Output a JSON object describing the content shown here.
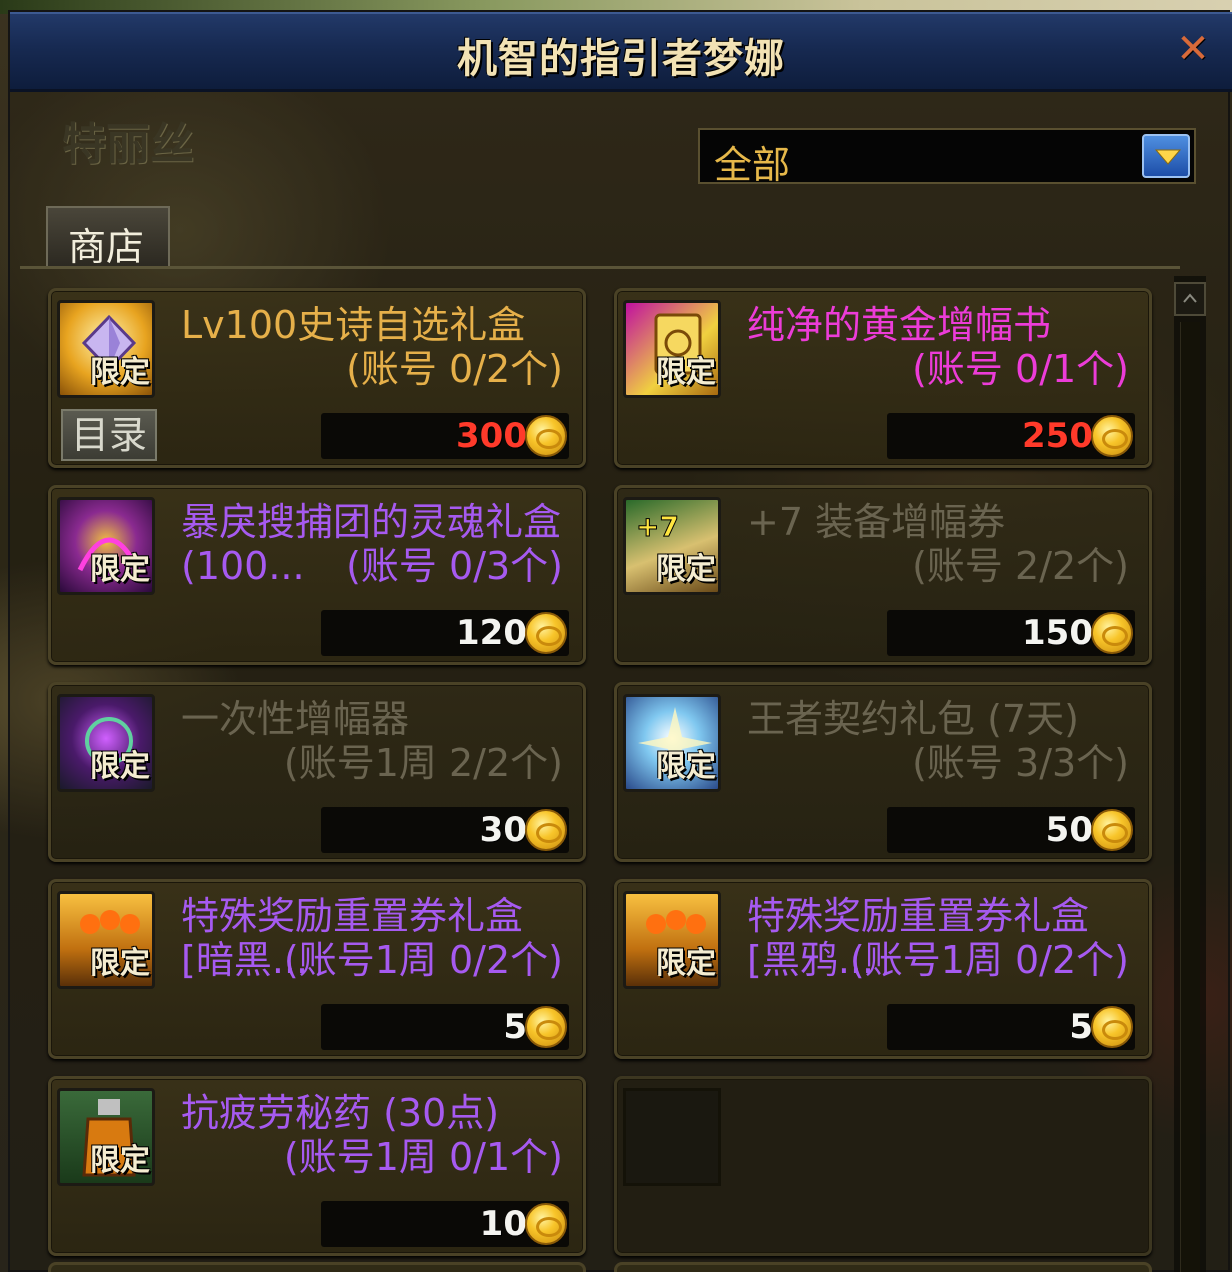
{
  "window": {
    "title": "机智的指引者梦娜",
    "npc_name": "特丽丝",
    "shop_tab": "商店",
    "catalog_button": "目录"
  },
  "filter": {
    "selected": "全部"
  },
  "colors": {
    "title_bar": "#172a52",
    "name_gold": "#e6b04a",
    "name_pink": "#ec3cd8",
    "name_purple": "#a65af0",
    "name_gray": "#6a6450",
    "price_red": "#ff3a2a",
    "price_white": "#f4f4f0"
  },
  "items": [
    {
      "name": "Lv100史诗自选礼盒",
      "limit": "(账号 0/2个)",
      "badge": "限定",
      "price": "300",
      "icon": "epic-box-icon",
      "name_color": "gold",
      "price_color": "red"
    },
    {
      "name": "纯净的黄金增幅书",
      "limit": "(账号 0/1个)",
      "badge": "限定",
      "price": "250",
      "icon": "gold-book-icon",
      "name_color": "pink",
      "price_color": "red"
    },
    {
      "name": "暴戾搜捕团的灵魂礼盒 (100...",
      "limit": "(账号 0/3个)",
      "badge": "限定",
      "price": "120",
      "icon": "soul-box-icon",
      "name_color": "purple",
      "price_color": "white"
    },
    {
      "name": "+7 装备增幅券",
      "limit": "(账号 2/2个)",
      "badge": "限定",
      "price": "150",
      "icon": "amplify-ticket-icon",
      "name_color": "gray",
      "price_color": "white"
    },
    {
      "name": "一次性增幅器",
      "limit": "(账号1周 2/2个)",
      "badge": "限定",
      "price": "30",
      "icon": "amplifier-icon",
      "name_color": "gray",
      "price_color": "white"
    },
    {
      "name": "王者契约礼包 (7天)",
      "limit": "(账号 3/3个)",
      "badge": "限定",
      "price": "50",
      "icon": "contract-pack-icon",
      "name_color": "gray",
      "price_color": "white"
    },
    {
      "name": "特殊奖励重置券礼盒[暗黑...",
      "limit": "(账号1周 0/2个)",
      "badge": "限定",
      "price": "5",
      "icon": "reset-ticket-box-icon",
      "name_color": "purple",
      "price_color": "white"
    },
    {
      "name": "特殊奖励重置券礼盒[黑鸦...",
      "limit": "(账号1周 0/2个)",
      "badge": "限定",
      "price": "5",
      "icon": "reset-ticket-box-icon",
      "name_color": "purple",
      "price_color": "white"
    },
    {
      "name": "抗疲劳秘药 (30点)",
      "limit": "(账号1周 0/1个)",
      "badge": "限定",
      "price": "10",
      "icon": "potion-icon",
      "name_color": "purple",
      "price_color": "white"
    }
  ]
}
